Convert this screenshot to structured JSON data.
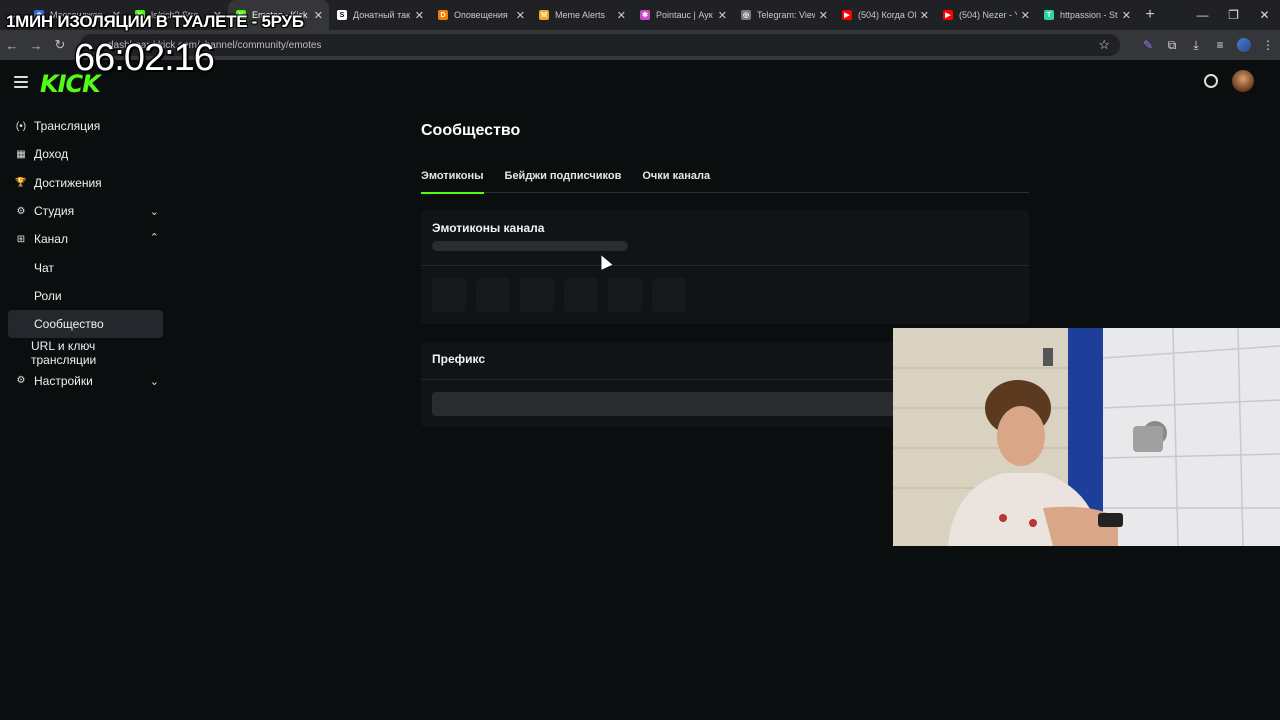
{
  "stream_overlay": {
    "title": "1МИН ИЗОЛЯЦИИ В ТУАЛЕТЕ - 5РУБ",
    "timer": "66:02:16"
  },
  "browser": {
    "tabs": [
      {
        "label": "Мессенджер",
        "icon": "messenger-icon",
        "color": "#2d6cdf",
        "glyph": "◉",
        "active": false
      },
      {
        "label": "ls/rich? Stre",
        "icon": "kick-icon",
        "color": "#53fc18",
        "glyph": "K",
        "active": false
      },
      {
        "label": "Emotes - Kick",
        "icon": "kick-icon",
        "color": "#53fc18",
        "glyph": "K",
        "active": true
      },
      {
        "label": "Донатный так",
        "icon": "s-icon",
        "color": "#ffffff",
        "glyph": "S",
        "active": false
      },
      {
        "label": "Оповещения",
        "icon": "donationalerts-icon",
        "color": "#f57d07",
        "glyph": "D",
        "active": false
      },
      {
        "label": "Meme Alerts",
        "icon": "memealerts-icon",
        "color": "#f5a623",
        "glyph": "M",
        "active": false
      },
      {
        "label": "Pointauc | Аук",
        "icon": "pointauc-icon",
        "color": "#c94bc9",
        "glyph": "✱",
        "active": false
      },
      {
        "label": "Telegram: View",
        "icon": "globe-icon",
        "color": "#7a7a7a",
        "glyph": "◎",
        "active": false
      },
      {
        "label": "(504) Когда Ol",
        "icon": "youtube-icon",
        "color": "#ff0000",
        "glyph": "▶",
        "active": false
      },
      {
        "label": "(504) Nezer - Y",
        "icon": "youtube-icon",
        "color": "#ff0000",
        "glyph": "▶",
        "active": false
      },
      {
        "label": "httpassion - St",
        "icon": "tt-icon",
        "color": "#2bd4a4",
        "glyph": "T",
        "active": false
      }
    ],
    "url": "dashboard.kick.com/channel/community/emotes"
  },
  "sidebar": {
    "items": [
      {
        "label": "Трансляция",
        "icon": "broadcast-icon",
        "glyph": "(•)"
      },
      {
        "label": "Доход",
        "icon": "revenue-icon",
        "glyph": "▦"
      },
      {
        "label": "Достижения",
        "icon": "trophy-icon",
        "glyph": "🏆"
      },
      {
        "label": "Студия",
        "icon": "studio-icon",
        "glyph": "⚙"
      },
      {
        "label": "Канал",
        "icon": "channel-icon",
        "glyph": "⊞"
      }
    ],
    "channel_sub": [
      "Чат",
      "Роли",
      "Сообщество",
      "URL и ключ трансляции"
    ],
    "settings": {
      "label": "Настройки",
      "icon": "settings-icon",
      "glyph": "⚙"
    }
  },
  "main": {
    "title": "Сообщество",
    "tabs": [
      "Эмотиконы",
      "Бейджи подписчиков",
      "Очки канала"
    ],
    "emotes_card_title": "Эмотиконы канала",
    "prefix_card_title": "Префикс"
  }
}
